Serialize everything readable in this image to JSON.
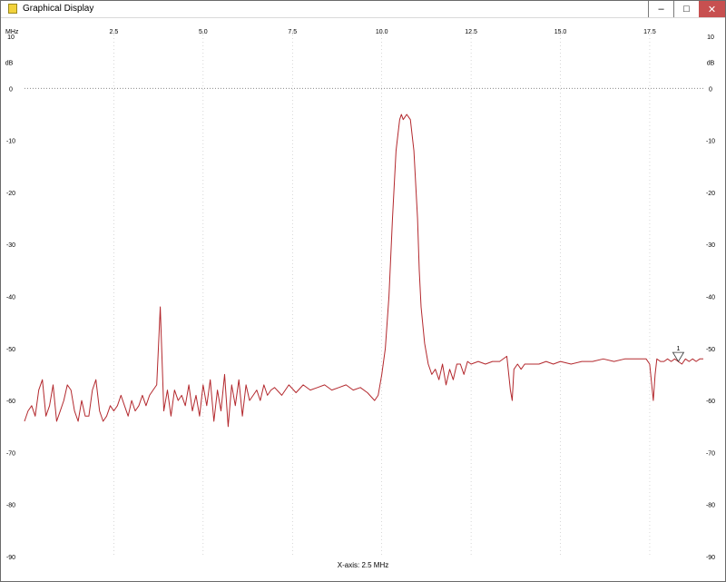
{
  "window": {
    "title": "Graphical Display",
    "icon": "notepad-icon",
    "minimize_glyph": "–",
    "maximize_glyph": "□",
    "close_glyph": "✕"
  },
  "colors": {
    "trace": "#b3282d",
    "grid": "#bdbdbd",
    "close_button": "#c75050"
  },
  "x_axis_caption": "X-axis: 2.5 MHz",
  "chart_data": {
    "type": "line",
    "xunit_label": "MHz",
    "yunit_label": "dB",
    "xlim": [
      0,
      19
    ],
    "ylim": [
      -90,
      10
    ],
    "x_ticks": [
      2.5,
      5.0,
      7.5,
      10.0,
      12.5,
      15.0,
      17.5
    ],
    "x_tick_labels": [
      "2.5",
      "5.0",
      "7.5",
      "10.0",
      "12.5",
      "15.0",
      "17.5"
    ],
    "y_ticks": [
      10,
      0,
      -10,
      -20,
      -30,
      -40,
      -50,
      -60,
      -70,
      -80,
      -90
    ],
    "y_tick_labels": [
      "10",
      "0",
      "-10",
      "-20",
      "-30",
      "-40",
      "-50",
      "-60",
      "-70",
      "-80",
      "-90"
    ],
    "reference_line_y": 0,
    "grid": true,
    "marker": {
      "label": "1",
      "x": 18.3,
      "y": -52.5
    },
    "series": [
      {
        "x": [
          0,
          0.1,
          0.2,
          0.3,
          0.4,
          0.5,
          0.6,
          0.7,
          0.8,
          0.9,
          1.0,
          1.1,
          1.2,
          1.3,
          1.4,
          1.5,
          1.6,
          1.7,
          1.8,
          1.9,
          2.0,
          2.1,
          2.2,
          2.3,
          2.4,
          2.5,
          2.6,
          2.7,
          2.8,
          2.9,
          3.0,
          3.1,
          3.2,
          3.3,
          3.4,
          3.5,
          3.6,
          3.7,
          3.8,
          3.9,
          4.0,
          4.1,
          4.2,
          4.3,
          4.4,
          4.5,
          4.6,
          4.7,
          4.8,
          4.9,
          5.0,
          5.1,
          5.2,
          5.3,
          5.4,
          5.5,
          5.6,
          5.7,
          5.8,
          5.9,
          6.0,
          6.1,
          6.2,
          6.3,
          6.4,
          6.5,
          6.6,
          6.7,
          6.8,
          6.9,
          7.0,
          7.2,
          7.4,
          7.6,
          7.8,
          8.0,
          8.2,
          8.4,
          8.6,
          8.8,
          9.0,
          9.2,
          9.4,
          9.6,
          9.8,
          9.9,
          10.0,
          10.1,
          10.2,
          10.3,
          10.4,
          10.5,
          10.55,
          10.6,
          10.7,
          10.8,
          10.9,
          11.0,
          11.05,
          11.1,
          11.2,
          11.3,
          11.4,
          11.5,
          11.6,
          11.7,
          11.8,
          11.9,
          12.0,
          12.1,
          12.2,
          12.3,
          12.4,
          12.5,
          12.7,
          12.9,
          13.1,
          13.3,
          13.5,
          13.6,
          13.65,
          13.7,
          13.8,
          13.9,
          14.0,
          14.2,
          14.4,
          14.6,
          14.8,
          15.0,
          15.3,
          15.6,
          15.9,
          16.2,
          16.5,
          16.8,
          17.1,
          17.4,
          17.5,
          17.6,
          17.65,
          17.7,
          17.8,
          17.9,
          18.0,
          18.1,
          18.2,
          18.3,
          18.4,
          18.5,
          18.6,
          18.7,
          18.8,
          18.9,
          19.0
        ],
        "y": [
          -64,
          -62,
          -61,
          -63,
          -58,
          -56,
          -63,
          -61,
          -57,
          -64,
          -62,
          -60,
          -57,
          -58,
          -62,
          -64,
          -60,
          -63,
          -63,
          -58,
          -56,
          -62,
          -64,
          -63,
          -61,
          -62,
          -61,
          -59,
          -61,
          -63,
          -60,
          -62,
          -61,
          -59,
          -61,
          -59,
          -58,
          -57,
          -42,
          -62,
          -58,
          -63,
          -58,
          -60,
          -59,
          -61,
          -57,
          -62,
          -59,
          -63,
          -57,
          -61,
          -56,
          -64,
          -58,
          -62,
          -55,
          -65,
          -57,
          -61,
          -56,
          -63,
          -57,
          -60,
          -59,
          -58,
          -60,
          -57,
          -59,
          -58,
          -57.5,
          -59,
          -57,
          -58.5,
          -57,
          -58,
          -57.5,
          -57,
          -58,
          -57.5,
          -57,
          -58,
          -57.5,
          -58.5,
          -60,
          -59,
          -55,
          -50,
          -40,
          -25,
          -12,
          -6,
          -5,
          -6,
          -5,
          -6,
          -12,
          -25,
          -35,
          -42,
          -49,
          -53,
          -55,
          -54,
          -56,
          -53,
          -57,
          -54,
          -56,
          -53,
          -53,
          -55,
          -52.5,
          -53,
          -52.5,
          -53,
          -52.5,
          -52.5,
          -51.5,
          -58,
          -60,
          -54,
          -53,
          -54,
          -53,
          -53,
          -53,
          -52.5,
          -53,
          -52.5,
          -53,
          -52.5,
          -52.5,
          -52,
          -52.5,
          -52,
          -52,
          -52,
          -53,
          -60,
          -55,
          -52,
          -52.5,
          -52.5,
          -52,
          -52.5,
          -52,
          -52.5,
          -53,
          -52,
          -52.5,
          -52,
          -52.5,
          -52,
          -52
        ]
      }
    ]
  }
}
